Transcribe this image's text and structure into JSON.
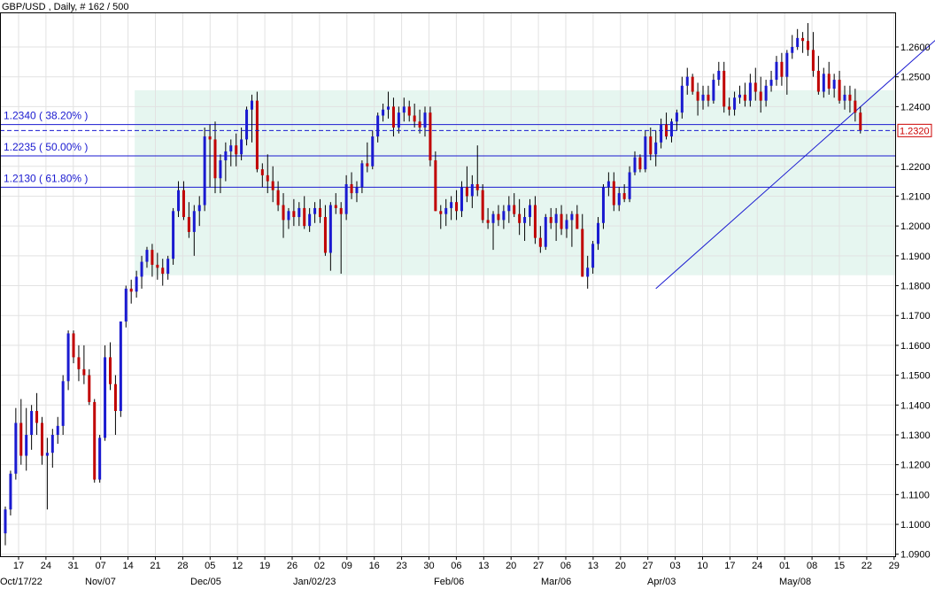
{
  "chart_data": {
    "type": "candlestick",
    "title": "GBP/USD , Daily, # 162 / 500",
    "y_axis": {
      "min": 1.09,
      "max": 1.265,
      "side": "right",
      "ticks": [
        "1.2600",
        "1.2500",
        "1.2400",
        "1.2300",
        "1.2200",
        "1.2100",
        "1.2000",
        "1.1900",
        "1.1800",
        "1.1700",
        "1.1600",
        "1.1500",
        "1.1400",
        "1.1300",
        "1.1200",
        "1.1100",
        "1.1000",
        "1.0900"
      ]
    },
    "x_axis": {
      "day_ticks": [
        "17",
        "24",
        "31",
        "07",
        "14",
        "21",
        "28",
        "05",
        "12",
        "19",
        "26",
        "02",
        "09",
        "16",
        "23",
        "30",
        "06",
        "13",
        "20",
        "27",
        "06",
        "13",
        "20",
        "27",
        "03",
        "10",
        "17",
        "24",
        "01",
        "08",
        "15",
        "22",
        "29"
      ],
      "month_labels": [
        "Oct/17/22",
        "Nov/07",
        "Dec/05",
        "Jan/02/23",
        "Feb/06",
        "Mar/06",
        "Apr/03",
        "May/08"
      ]
    },
    "fib_levels": [
      {
        "label": "1.2340 ( 38.20% )",
        "value": 1.234
      },
      {
        "label": "1.2235 ( 50.00% )",
        "value": 1.2235
      },
      {
        "label": "1.2130 ( 61.80% )",
        "value": 1.213
      }
    ],
    "range_box": {
      "from_index": 25,
      "top": 1.2455,
      "bottom": 1.1835
    },
    "trendline": {
      "from": {
        "index": 124,
        "value": 1.179
      },
      "to": {
        "index": 180,
        "value": 1.2665
      }
    },
    "current_price": {
      "label": "1.2320",
      "value": 1.232
    },
    "candles": [
      [
        1.097,
        1.106,
        1.093,
        1.105
      ],
      [
        1.105,
        1.118,
        1.103,
        1.117
      ],
      [
        1.117,
        1.139,
        1.115,
        1.134
      ],
      [
        1.134,
        1.142,
        1.12,
        1.123
      ],
      [
        1.123,
        1.139,
        1.118,
        1.13
      ],
      [
        1.13,
        1.14,
        1.125,
        1.138
      ],
      [
        1.138,
        1.144,
        1.13,
        1.134
      ],
      [
        1.134,
        1.136,
        1.12,
        1.123
      ],
      [
        1.123,
        1.129,
        1.105,
        1.124
      ],
      [
        1.124,
        1.132,
        1.119,
        1.13
      ],
      [
        1.13,
        1.136,
        1.127,
        1.133
      ],
      [
        1.133,
        1.15,
        1.13,
        1.148
      ],
      [
        1.148,
        1.165,
        1.145,
        1.164
      ],
      [
        1.164,
        1.165,
        1.154,
        1.156
      ],
      [
        1.156,
        1.16,
        1.148,
        1.152
      ],
      [
        1.152,
        1.16,
        1.147,
        1.15
      ],
      [
        1.15,
        1.152,
        1.14,
        1.141
      ],
      [
        1.141,
        1.142,
        1.114,
        1.115
      ],
      [
        1.115,
        1.13,
        1.114,
        1.129
      ],
      [
        1.129,
        1.16,
        1.128,
        1.156
      ],
      [
        1.156,
        1.161,
        1.145,
        1.147
      ],
      [
        1.147,
        1.15,
        1.13,
        1.138
      ],
      [
        1.138,
        1.168,
        1.136,
        1.168
      ],
      [
        1.168,
        1.18,
        1.166,
        1.179
      ],
      [
        1.179,
        1.182,
        1.174,
        1.178
      ],
      [
        1.178,
        1.185,
        1.176,
        1.183
      ],
      [
        1.183,
        1.19,
        1.179,
        1.188
      ],
      [
        1.188,
        1.193,
        1.186,
        1.192
      ],
      [
        1.192,
        1.194,
        1.183,
        1.187
      ],
      [
        1.187,
        1.191,
        1.182,
        1.186
      ],
      [
        1.186,
        1.189,
        1.18,
        1.184
      ],
      [
        1.184,
        1.19,
        1.182,
        1.189
      ],
      [
        1.189,
        1.206,
        1.187,
        1.205
      ],
      [
        1.205,
        1.215,
        1.203,
        1.212
      ],
      [
        1.212,
        1.215,
        1.202,
        1.203
      ],
      [
        1.203,
        1.208,
        1.196,
        1.198
      ],
      [
        1.198,
        1.207,
        1.19,
        1.205
      ],
      [
        1.205,
        1.21,
        1.2,
        1.207
      ],
      [
        1.207,
        1.233,
        1.205,
        1.23
      ],
      [
        1.23,
        1.234,
        1.213,
        1.229
      ],
      [
        1.229,
        1.235,
        1.211,
        1.216
      ],
      [
        1.216,
        1.224,
        1.211,
        1.222
      ],
      [
        1.222,
        1.228,
        1.215,
        1.225
      ],
      [
        1.225,
        1.229,
        1.22,
        1.227
      ],
      [
        1.227,
        1.231,
        1.22,
        1.224
      ],
      [
        1.224,
        1.233,
        1.222,
        1.229
      ],
      [
        1.229,
        1.24,
        1.227,
        1.239
      ],
      [
        1.239,
        1.244,
        1.228,
        1.242
      ],
      [
        1.242,
        1.245,
        1.218,
        1.219
      ],
      [
        1.219,
        1.221,
        1.213,
        1.217
      ],
      [
        1.217,
        1.224,
        1.211,
        1.215
      ],
      [
        1.215,
        1.22,
        1.208,
        1.212
      ],
      [
        1.212,
        1.215,
        1.205,
        1.207
      ],
      [
        1.207,
        1.211,
        1.196,
        1.202
      ],
      [
        1.202,
        1.206,
        1.199,
        1.205
      ],
      [
        1.205,
        1.209,
        1.2,
        1.203
      ],
      [
        1.203,
        1.208,
        1.2,
        1.206
      ],
      [
        1.206,
        1.21,
        1.199,
        1.2
      ],
      [
        1.2,
        1.206,
        1.198,
        1.204
      ],
      [
        1.204,
        1.208,
        1.201,
        1.206
      ],
      [
        1.206,
        1.209,
        1.201,
        1.203
      ],
      [
        1.203,
        1.207,
        1.19,
        1.191
      ],
      [
        1.191,
        1.208,
        1.185,
        1.207
      ],
      [
        1.207,
        1.211,
        1.204,
        1.206
      ],
      [
        1.206,
        1.208,
        1.184,
        1.204
      ],
      [
        1.204,
        1.217,
        1.202,
        1.214
      ],
      [
        1.214,
        1.218,
        1.209,
        1.211
      ],
      [
        1.211,
        1.215,
        1.208,
        1.213
      ],
      [
        1.213,
        1.222,
        1.211,
        1.221
      ],
      [
        1.221,
        1.228,
        1.218,
        1.22
      ],
      [
        1.22,
        1.232,
        1.219,
        1.23
      ],
      [
        1.23,
        1.238,
        1.228,
        1.237
      ],
      [
        1.237,
        1.241,
        1.235,
        1.239
      ],
      [
        1.239,
        1.245,
        1.236,
        1.24
      ],
      [
        1.24,
        1.243,
        1.23,
        1.233
      ],
      [
        1.233,
        1.24,
        1.231,
        1.238
      ],
      [
        1.238,
        1.243,
        1.235,
        1.24
      ],
      [
        1.24,
        1.242,
        1.235,
        1.237
      ],
      [
        1.237,
        1.241,
        1.233,
        1.235
      ],
      [
        1.235,
        1.239,
        1.231,
        1.233
      ],
      [
        1.233,
        1.24,
        1.23,
        1.238
      ],
      [
        1.238,
        1.24,
        1.22,
        1.222
      ],
      [
        1.222,
        1.225,
        1.205,
        1.205
      ],
      [
        1.205,
        1.207,
        1.199,
        1.204
      ],
      [
        1.204,
        1.209,
        1.2,
        1.206
      ],
      [
        1.206,
        1.21,
        1.202,
        1.208
      ],
      [
        1.208,
        1.212,
        1.202,
        1.205
      ],
      [
        1.205,
        1.215,
        1.203,
        1.213
      ],
      [
        1.213,
        1.22,
        1.208,
        1.21
      ],
      [
        1.21,
        1.217,
        1.206,
        1.214
      ],
      [
        1.214,
        1.227,
        1.21,
        1.212
      ],
      [
        1.212,
        1.214,
        1.201,
        1.202
      ],
      [
        1.202,
        1.206,
        1.199,
        1.201
      ],
      [
        1.201,
        1.205,
        1.192,
        1.204
      ],
      [
        1.204,
        1.207,
        1.2,
        1.202
      ],
      [
        1.202,
        1.207,
        1.199,
        1.205
      ],
      [
        1.205,
        1.21,
        1.201,
        1.207
      ],
      [
        1.207,
        1.211,
        1.203,
        1.204
      ],
      [
        1.204,
        1.209,
        1.197,
        1.201
      ],
      [
        1.201,
        1.206,
        1.195,
        1.203
      ],
      [
        1.203,
        1.209,
        1.2,
        1.207
      ],
      [
        1.207,
        1.21,
        1.194,
        1.196
      ],
      [
        1.196,
        1.2,
        1.191,
        1.193
      ],
      [
        1.193,
        1.204,
        1.192,
        1.203
      ],
      [
        1.203,
        1.206,
        1.199,
        1.201
      ],
      [
        1.201,
        1.206,
        1.195,
        1.204
      ],
      [
        1.204,
        1.207,
        1.197,
        1.199
      ],
      [
        1.199,
        1.204,
        1.196,
        1.202
      ],
      [
        1.202,
        1.205,
        1.193,
        1.204
      ],
      [
        1.204,
        1.207,
        1.2,
        1.199
      ],
      [
        1.199,
        1.204,
        1.183,
        1.183
      ],
      [
        1.183,
        1.19,
        1.179,
        1.186
      ],
      [
        1.186,
        1.195,
        1.184,
        1.194
      ],
      [
        1.194,
        1.203,
        1.192,
        1.201
      ],
      [
        1.201,
        1.214,
        1.199,
        1.213
      ],
      [
        1.213,
        1.218,
        1.21,
        1.215
      ],
      [
        1.215,
        1.218,
        1.205,
        1.207
      ],
      [
        1.207,
        1.213,
        1.205,
        1.211
      ],
      [
        1.211,
        1.214,
        1.208,
        1.209
      ],
      [
        1.209,
        1.22,
        1.208,
        1.218
      ],
      [
        1.218,
        1.225,
        1.217,
        1.223
      ],
      [
        1.223,
        1.224,
        1.218,
        1.219
      ],
      [
        1.219,
        1.232,
        1.218,
        1.23
      ],
      [
        1.23,
        1.233,
        1.222,
        1.224
      ],
      [
        1.224,
        1.232,
        1.22,
        1.228
      ],
      [
        1.228,
        1.236,
        1.226,
        1.234
      ],
      [
        1.234,
        1.238,
        1.229,
        1.23
      ],
      [
        1.23,
        1.236,
        1.228,
        1.235
      ],
      [
        1.235,
        1.239,
        1.232,
        1.238
      ],
      [
        1.238,
        1.25,
        1.236,
        1.247
      ],
      [
        1.247,
        1.253,
        1.244,
        1.25
      ],
      [
        1.25,
        1.251,
        1.244,
        1.245
      ],
      [
        1.245,
        1.248,
        1.237,
        1.242
      ],
      [
        1.242,
        1.247,
        1.239,
        1.244
      ],
      [
        1.244,
        1.247,
        1.24,
        1.242
      ],
      [
        1.242,
        1.251,
        1.241,
        1.249
      ],
      [
        1.249,
        1.255,
        1.247,
        1.252
      ],
      [
        1.252,
        1.255,
        1.238,
        1.24
      ],
      [
        1.24,
        1.243,
        1.237,
        1.239
      ],
      [
        1.239,
        1.245,
        1.237,
        1.243
      ],
      [
        1.243,
        1.247,
        1.241,
        1.244
      ],
      [
        1.244,
        1.248,
        1.24,
        1.242
      ],
      [
        1.242,
        1.251,
        1.24,
        1.248
      ],
      [
        1.248,
        1.253,
        1.242,
        1.245
      ],
      [
        1.245,
        1.25,
        1.238,
        1.242
      ],
      [
        1.242,
        1.249,
        1.24,
        1.247
      ],
      [
        1.247,
        1.252,
        1.245,
        1.249
      ],
      [
        1.249,
        1.257,
        1.247,
        1.255
      ],
      [
        1.255,
        1.258,
        1.247,
        1.25
      ],
      [
        1.25,
        1.259,
        1.244,
        1.258
      ],
      [
        1.258,
        1.264,
        1.256,
        1.26
      ],
      [
        1.26,
        1.266,
        1.259,
        1.263
      ],
      [
        1.263,
        1.265,
        1.258,
        1.262
      ],
      [
        1.262,
        1.268,
        1.257,
        1.259
      ],
      [
        1.259,
        1.265,
        1.25,
        1.252
      ],
      [
        1.252,
        1.257,
        1.244,
        1.245
      ],
      [
        1.245,
        1.253,
        1.243,
        1.251
      ],
      [
        1.251,
        1.255,
        1.244,
        1.246
      ],
      [
        1.246,
        1.251,
        1.243,
        1.249
      ],
      [
        1.249,
        1.252,
        1.241,
        1.242
      ],
      [
        1.242,
        1.247,
        1.239,
        1.244
      ],
      [
        1.244,
        1.247,
        1.238,
        1.242
      ],
      [
        1.242,
        1.246,
        1.235,
        1.238
      ],
      [
        1.238,
        1.24,
        1.231,
        1.232
      ]
    ]
  }
}
